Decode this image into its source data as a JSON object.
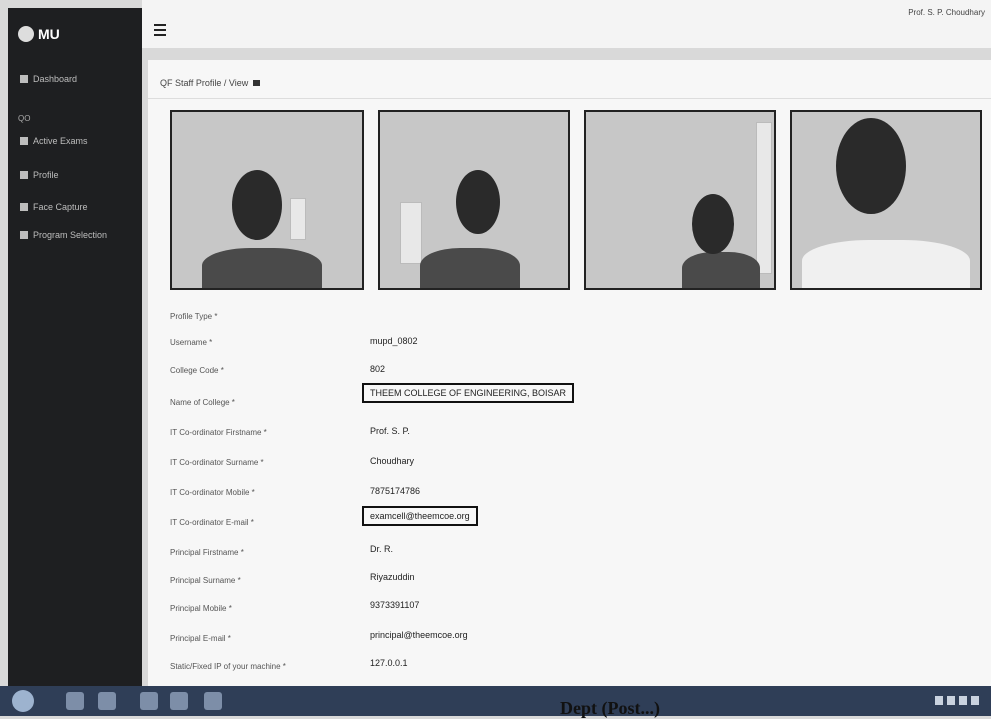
{
  "brand": "MU",
  "user": "Prof. S. P. Choudhary",
  "sidebar": {
    "dashboard": "Dashboard",
    "section": "QO",
    "items": [
      "Active Exams",
      "Profile",
      "Face Capture",
      "Program Selection"
    ]
  },
  "panel_title": "QF Staff Profile / View",
  "fields": [
    {
      "label": "Profile Type *",
      "value": ""
    },
    {
      "label": "Username *",
      "value": "mupd_0802"
    },
    {
      "label": "College Code *",
      "value": "802"
    },
    {
      "label": "Name of College *",
      "value": "THEEM COLLEGE OF ENGINEERING, BOISAR"
    },
    {
      "label": "IT Co-ordinator Firstname *",
      "value": "Prof. S. P."
    },
    {
      "label": "IT Co-ordinator Surname *",
      "value": "Choudhary"
    },
    {
      "label": "IT Co-ordinator Mobile *",
      "value": "7875174786"
    },
    {
      "label": "IT Co-ordinator E-mail *",
      "value": "examcell@theemcoe.org"
    },
    {
      "label": "Principal Firstname *",
      "value": "Dr. R."
    },
    {
      "label": "Principal Surname *",
      "value": "Riyazuddin"
    },
    {
      "label": "Principal Mobile *",
      "value": "9373391107"
    },
    {
      "label": "Principal E-mail *",
      "value": "principal@theemcoe.org"
    },
    {
      "label": "Static/Fixed IP of your machine *",
      "value": "127.0.0.1"
    }
  ],
  "caption": "Dept (Post...)"
}
